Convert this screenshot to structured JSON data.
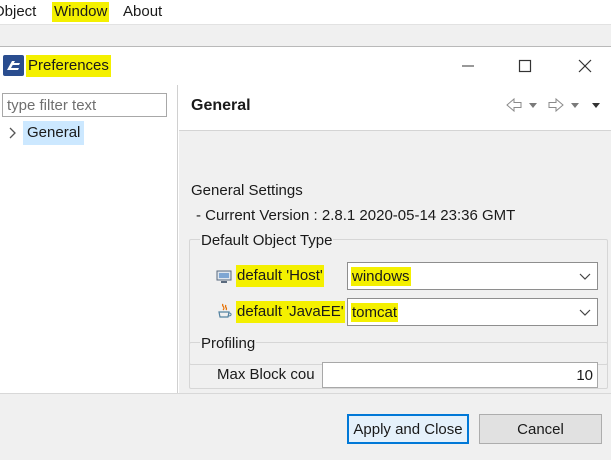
{
  "menubar": {
    "items": [
      {
        "label": "Object"
      },
      {
        "label": "Window"
      },
      {
        "label": "About"
      }
    ]
  },
  "dialog": {
    "title": "Preferences",
    "filter": {
      "placeholder": "type filter text",
      "value": ""
    },
    "tree": [
      {
        "label": "General",
        "selected": true
      }
    ],
    "page": {
      "title": "General",
      "settings_heading": "General Settings",
      "current_version": "- Current Version : 2.8.1 2020-05-14 23:36 GMT",
      "object_type_group": {
        "label": "Default Object Type",
        "host": {
          "label": "default 'Host'",
          "value": "windows",
          "icon": "monitor-icon"
        },
        "javaee": {
          "label": "default 'JavaEE'",
          "value": "tomcat",
          "icon": "java-icon"
        }
      },
      "profiling_group": {
        "label": "Profiling",
        "max_block_label": "Max Block cou",
        "max_block_value": "10"
      }
    },
    "buttons": {
      "apply_close": "Apply and Close",
      "cancel": "Cancel"
    }
  },
  "colors": {
    "highlight": "#f4f000",
    "selection": "#cce8ff",
    "default_button_border": "#0078d7"
  }
}
